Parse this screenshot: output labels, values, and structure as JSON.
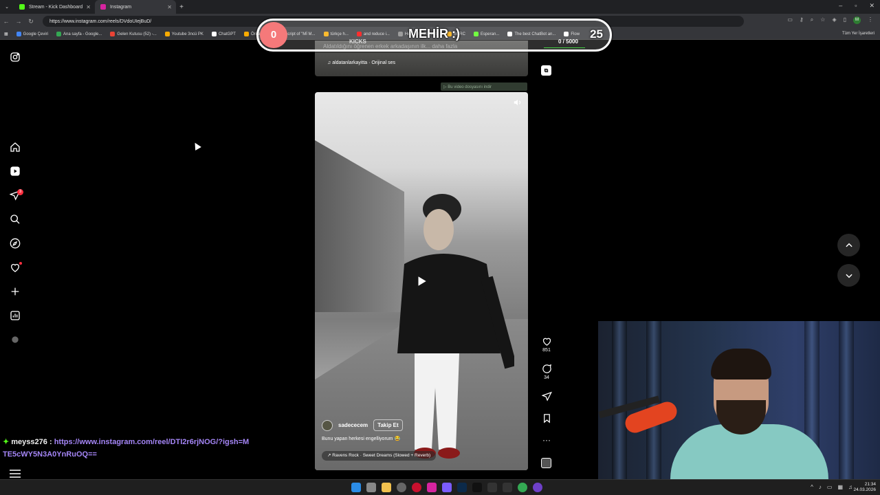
{
  "browser": {
    "tabs": [
      {
        "label": "Stream - Kick Dashboard",
        "color": "#53fc18"
      },
      {
        "label": "Instagram",
        "color": "#d6249f"
      }
    ],
    "url": "https://www.instagram.com/reels/DVdoUIejBuD/",
    "bookmarks": [
      {
        "label": "Google Çeviri",
        "color": "#4285f4"
      },
      {
        "label": "Ana sayfa - Google...",
        "color": "#34a853"
      },
      {
        "label": "Gelen Kutusu (52) -...",
        "color": "#ea4335"
      },
      {
        "label": "Youtube 3ncü PK",
        "color": "#f9ab00"
      },
      {
        "label": "ChatGPT",
        "color": "#ffffff"
      },
      {
        "label": "Örnek",
        "color": "#f9ab00"
      },
      {
        "label": "Transcript of \"Mİ M...",
        "color": "#888888"
      },
      {
        "label": "türkçe h...",
        "color": "#f9ab00"
      },
      {
        "label": "and reduce i...",
        "color": "#ff0000"
      },
      {
        "label": "HeyGen - Projects",
        "color": "#888888"
      },
      {
        "label": "BURC",
        "color": "#f9ab00"
      },
      {
        "label": "Esperan...",
        "color": "#53fc18"
      },
      {
        "label": "The best ChatBot an...",
        "color": "#ffffff"
      },
      {
        "label": "Flow",
        "color": "#ffffff"
      }
    ],
    "all_bookmarks": "Tüm Yer İşaretleri",
    "profile_initial": "M"
  },
  "overlay": {
    "goal_count": "0",
    "goal_title": "MEHİR :)",
    "goal_target": "25",
    "kicks_label": "KICKS",
    "kicks_progress": "0 / 5000"
  },
  "instagram": {
    "notification_count": "3",
    "prev_reel": {
      "caption": "Aldatıldığını öğrenen erkek arkadaşının ilk... daha fazla",
      "audio": "aldatanlarkayitta · Orijinal ses"
    },
    "download_banner": "▷ Bu video dosyasını indir",
    "reel": {
      "author": "sadececem",
      "follow_label": "Takip Et",
      "caption": "Bunu yapan herkesi engelliyorum 😂",
      "song": "Ravens Rock · Sweet Dreams (Slowed + Reverb)",
      "likes": "851",
      "comments": "34"
    }
  },
  "chat": {
    "username": "meyss276",
    "message": "https://www.instagram.com/reel/DTI2r6rjNOG/?igsh=MTE5cWY5N3A0YnRuOQ=="
  },
  "taskbar": {
    "time": "21:34",
    "date": "24.03.2026"
  }
}
